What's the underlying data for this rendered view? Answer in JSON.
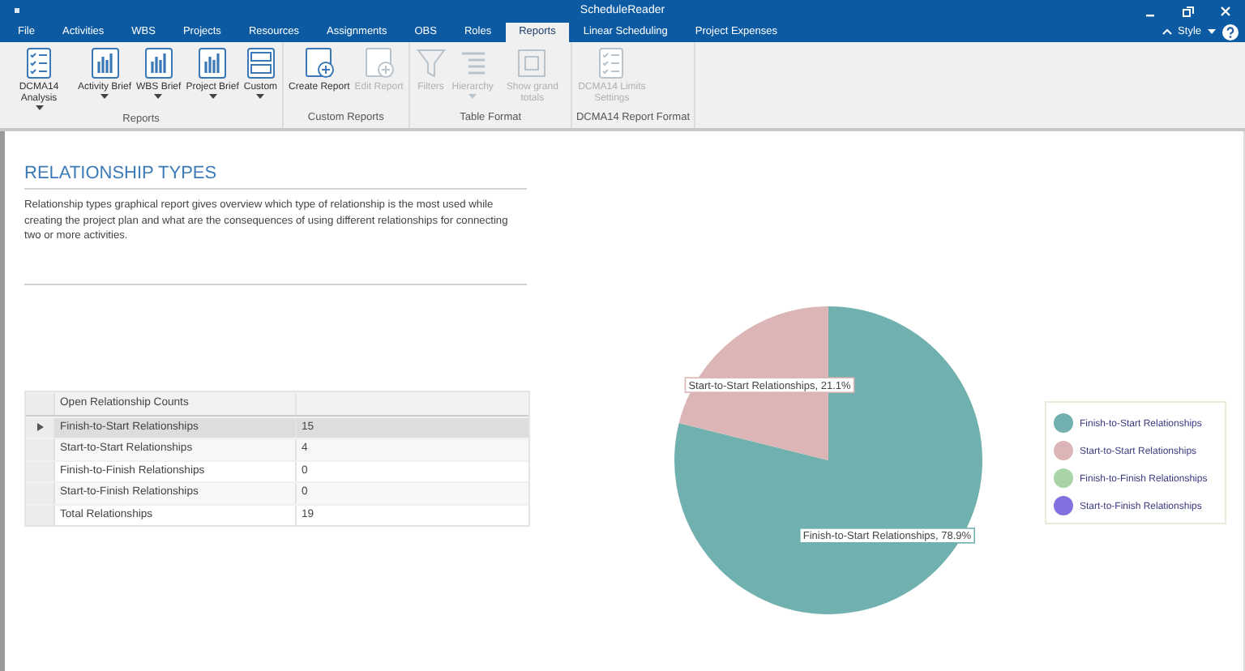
{
  "window": {
    "title": "ScheduleReader"
  },
  "tabs": [
    {
      "label": "File",
      "selected": false
    },
    {
      "label": "Activities",
      "selected": false
    },
    {
      "label": "WBS",
      "selected": false
    },
    {
      "label": "Projects",
      "selected": false
    },
    {
      "label": "Resources",
      "selected": false
    },
    {
      "label": "Assignments",
      "selected": false
    },
    {
      "label": "OBS",
      "selected": false
    },
    {
      "label": "Roles",
      "selected": false
    },
    {
      "label": "Reports",
      "selected": true
    },
    {
      "label": "Linear Scheduling",
      "selected": false
    },
    {
      "label": "Project Expenses",
      "selected": false
    }
  ],
  "style_menu": {
    "label": "Style"
  },
  "ribbon_groups": [
    {
      "label": "Reports",
      "buttons": [
        {
          "label": "DCMA14 Analysis",
          "dropdown": true,
          "disabled": false
        },
        {
          "label": "Activity Brief",
          "dropdown": true,
          "disabled": false
        },
        {
          "label": "WBS Brief",
          "dropdown": true,
          "disabled": false
        },
        {
          "label": "Project Brief",
          "dropdown": true,
          "disabled": false
        },
        {
          "label": "Custom",
          "dropdown": true,
          "disabled": false
        }
      ]
    },
    {
      "label": "Custom Reports",
      "buttons": [
        {
          "label": "Create Report",
          "dropdown": false,
          "disabled": false
        },
        {
          "label": "Edit Report",
          "dropdown": false,
          "disabled": true
        }
      ]
    },
    {
      "label": "Table Format",
      "buttons": [
        {
          "label": "Filters",
          "dropdown": false,
          "disabled": true
        },
        {
          "label": "Hierarchy",
          "dropdown": true,
          "disabled": true
        },
        {
          "label": "Show grand totals",
          "dropdown": false,
          "disabled": true
        }
      ]
    },
    {
      "label": "DCMA14 Report Format",
      "buttons": [
        {
          "label": "DCMA14 Limits Settings",
          "dropdown": false,
          "disabled": true
        }
      ]
    }
  ],
  "report": {
    "title": "RELATIONSHIP TYPES",
    "description": "Relationship types graphical report gives overview which type of relationship is the most used while creating the project plan and what are the consequences of using different relationships for connecting two or more activities."
  },
  "table": {
    "columns": [
      "Open Relationship Counts"
    ],
    "rows": [
      {
        "name": "Finish-to-Start Relationships",
        "count": "15",
        "selected": true
      },
      {
        "name": "Start-to-Start Relationships",
        "count": "4",
        "selected": false
      },
      {
        "name": "Finish-to-Finish Relationships",
        "count": "0",
        "selected": false
      },
      {
        "name": "Start-to-Finish Relationships",
        "count": "0",
        "selected": false
      },
      {
        "name": "Total Relationships",
        "count": "19",
        "selected": false
      }
    ]
  },
  "chart_data": {
    "type": "pie",
    "categories": [
      "Finish-to-Start Relationships",
      "Start-to-Start Relationships",
      "Finish-to-Finish Relationships",
      "Start-to-Finish Relationships"
    ],
    "values": [
      78.9,
      21.1,
      0,
      0
    ],
    "legend": true,
    "value_labels": [
      "Finish-to-Start Relationships, 78.9%",
      "Start-to-Start Relationships, 21.1%",
      null,
      null
    ]
  }
}
